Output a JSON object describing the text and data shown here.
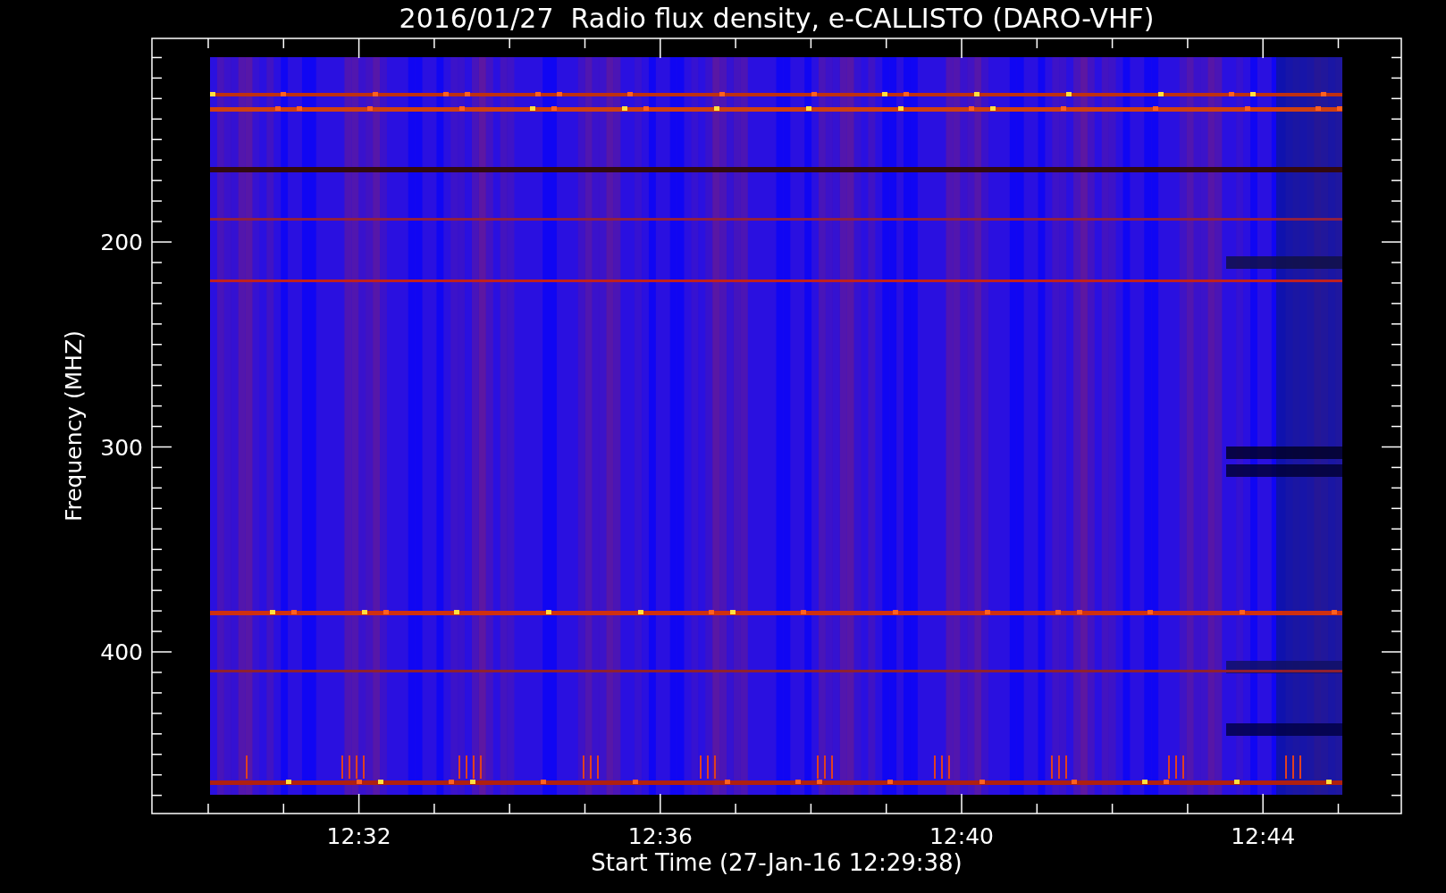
{
  "title": "2016/01/27  Radio flux density, e-CALLISTO (DARO-VHF)",
  "ylabel": "Frequency (MHZ)",
  "xlabel": "Start Time (27-Jan-16 12:29:38)",
  "yticks": [
    "200",
    "300",
    "400"
  ],
  "xticks": [
    "12:32",
    "12:36",
    "12:40",
    "12:44"
  ]
}
